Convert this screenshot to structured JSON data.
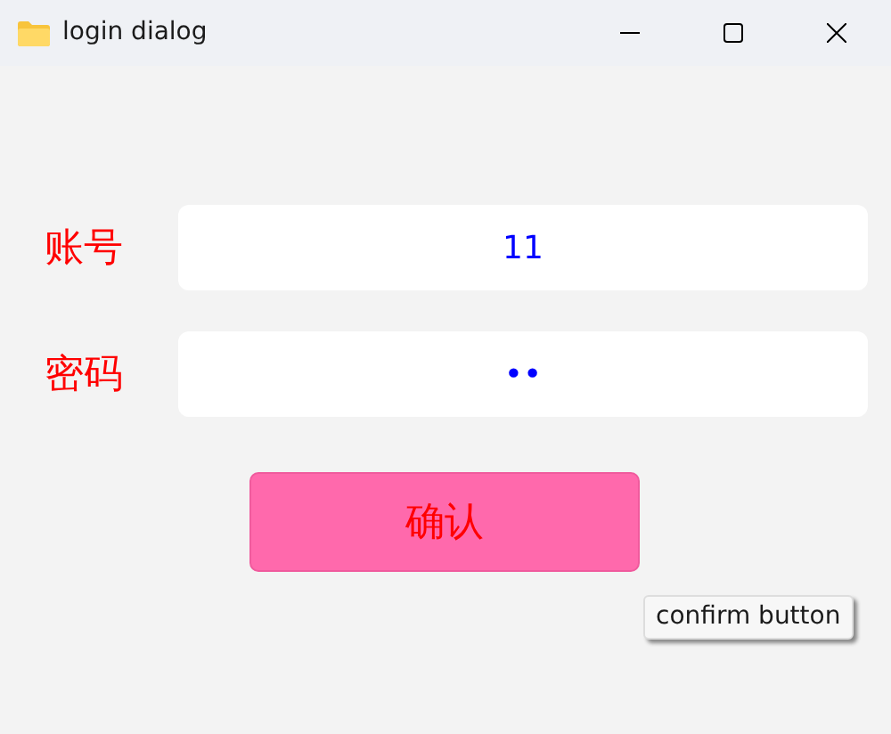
{
  "window": {
    "title": "login dialog"
  },
  "fields": [
    {
      "label": "账号",
      "value": "11"
    },
    {
      "label": "密码",
      "value": "••"
    }
  ],
  "confirm_button": {
    "label": "确认"
  },
  "tooltip": {
    "text": "confirm button"
  }
}
